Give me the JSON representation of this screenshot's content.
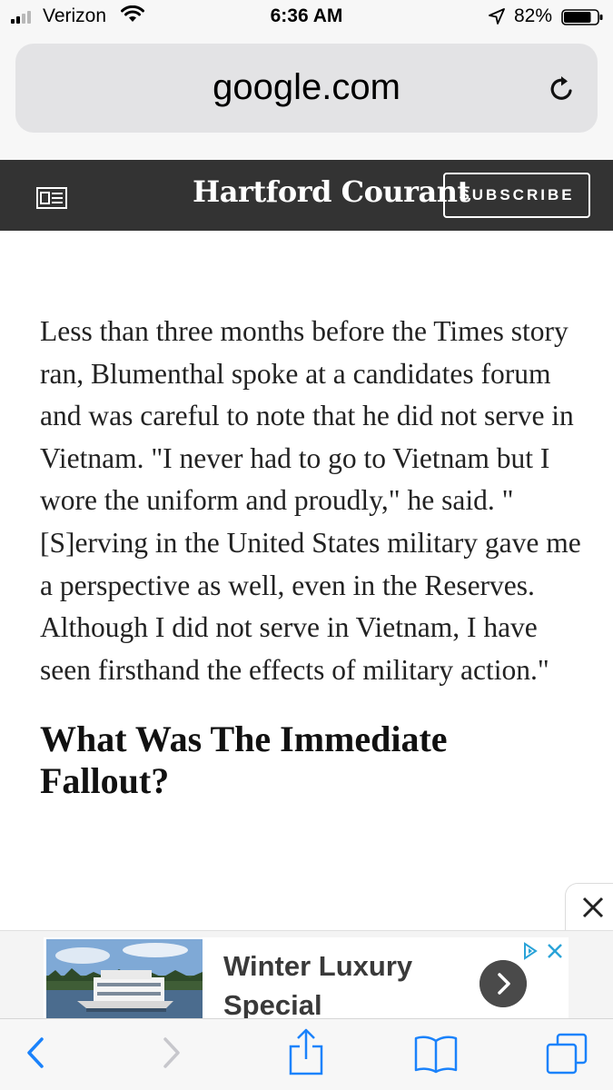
{
  "status_bar": {
    "carrier": "Verizon",
    "time": "6:36 AM",
    "battery_percent": "82%",
    "signal_bars": 2,
    "battery_level": 0.82
  },
  "browser": {
    "url": "google.com"
  },
  "site": {
    "masthead": "Hartford Courant",
    "subscribe_label": "SUBSCRIBE"
  },
  "article": {
    "paragraph": "Less than three months before the Times story ran, Blumenthal spoke at a candidates forum and was careful to note that he did not serve in Vietnam. \"I never had to go to Vietnam but I wore the uniform and proudly,\" he said. \" [S]erving in the United States military gave me a perspective as well, even in the Reserves. Although I did not serve in Vietnam, I have seen firsthand the effects of military action.\"",
    "subheading": "What Was The Immediate Fallout?"
  },
  "ad": {
    "title": "Winter Luxury Special"
  },
  "colors": {
    "header_bg": "#333333",
    "chrome_bg": "#f7f7f7",
    "ios_blue": "#1a82fb"
  },
  "icons": [
    "signal-icon",
    "wifi-icon",
    "location-icon",
    "battery-icon",
    "reload-icon",
    "menu-icon",
    "close-icon",
    "adchoices-icon",
    "chevron-right-icon",
    "back-icon",
    "forward-icon",
    "share-icon",
    "bookmarks-icon",
    "tabs-icon"
  ]
}
